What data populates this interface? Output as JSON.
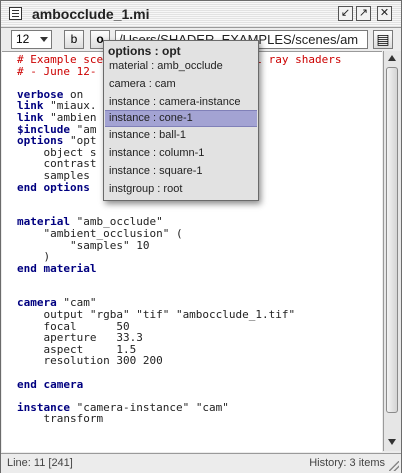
{
  "window": {
    "title": "ambocclude_1.mi"
  },
  "titlebar_buttons": {
    "shrink_glyph": "↙",
    "expand_glyph": "↗",
    "close_glyph": "✕"
  },
  "toolbar": {
    "font_size": "12",
    "bold_label": "b",
    "outline_label": "o",
    "path": "/Users/SHADER_EXAMPLES/scenes/am",
    "file_icon_glyph": "▤"
  },
  "editor": {
    "code": "# Example scene for the Mental mental ray shaders\n# - June 12-\n\nverbose on\nlink \"miaux.\nlink \"ambien\n$include \"am\noptions \"opt\n    object s\n    contrast\n    samples \nend options\n\n\nmaterial \"amb_occlude\"\n    \"ambient_occlusion\" (\n        \"samples\" 10\n    )\nend material\n\n\ncamera \"cam\"\n    output \"rgba\" \"tif\" \"ambocclude_1.tif\"\n    focal      50\n    aperture   33.3\n    aspect     1.5\n    resolution 300 200\n\nend camera\n\ninstance \"camera-instance\" \"cam\"\n    transform"
  },
  "popup": {
    "title": "options : opt",
    "items": [
      {
        "label": "material : amb_occlude"
      },
      {
        "label": "camera : cam"
      },
      {
        "label": "instance : camera-instance"
      },
      {
        "label": "instance : cone-1"
      },
      {
        "label": "instance : ball-1"
      },
      {
        "label": "instance : column-1"
      },
      {
        "label": "instance : square-1"
      },
      {
        "label": "instgroup : root"
      }
    ],
    "selected_index": 3
  },
  "status": {
    "line": "Line: 11 [241]",
    "history": "History: 3 items"
  },
  "colors": {
    "comment": "#cc0000",
    "keyword": "#000080",
    "highlight": "#a3a3d3"
  }
}
